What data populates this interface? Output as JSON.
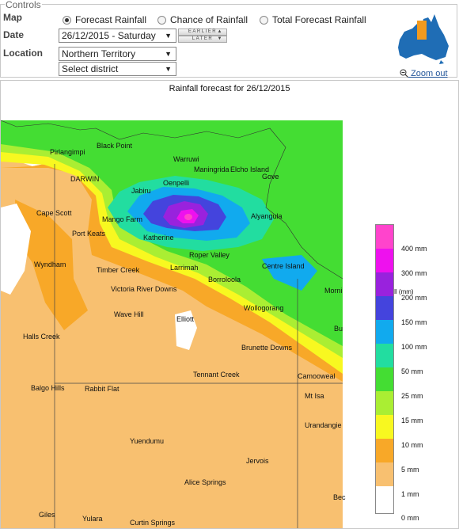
{
  "controls": {
    "legend": "Controls",
    "map_label": "Map",
    "date_label": "Date",
    "location_label": "Location",
    "map_options": [
      {
        "label": "Forecast Rainfall",
        "selected": true
      },
      {
        "label": "Chance of Rainfall",
        "selected": false
      },
      {
        "label": "Total Forecast Rainfall",
        "selected": false
      }
    ],
    "date_value": "26/12/2015 - Saturday",
    "earlier_label": "EARLIER",
    "later_label": "LATER",
    "location_value": "Northern Territory",
    "district_value": "Select district",
    "zoom_label": "Zoom out"
  },
  "map": {
    "title": "Rainfall forecast for 26/12/2015",
    "legend_title": "Rainfall (mm)",
    "legend": [
      {
        "label": "400 mm",
        "color": "#ff44cc"
      },
      {
        "label": "300 mm",
        "color": "#ee11ee"
      },
      {
        "label": "200 mm",
        "color": "#9922dd"
      },
      {
        "label": "150 mm",
        "color": "#4444dd"
      },
      {
        "label": "100 mm",
        "color": "#11aaee"
      },
      {
        "label": "50 mm",
        "color": "#22dda0"
      },
      {
        "label": "25 mm",
        "color": "#44dd33"
      },
      {
        "label": "15 mm",
        "color": "#aaee33"
      },
      {
        "label": "10 mm",
        "color": "#f8f820"
      },
      {
        "label": "5 mm",
        "color": "#f8a828"
      },
      {
        "label": "1 mm",
        "color": "#f8c070"
      },
      {
        "label": "0 mm",
        "color": "#ffffff"
      }
    ],
    "places": [
      "Pirlangimpi",
      "Black Point",
      "Warruwi",
      "Maningrida",
      "Elcho Island",
      "Gove",
      "DARWIN",
      "Oenpelli",
      "Jabiru",
      "Alyangula",
      "Cape Scott",
      "Mango Farm",
      "Port Keats",
      "Katherine",
      "Roper Valley",
      "Centre Island",
      "Wyndham",
      "Timber Creek",
      "Larrimah",
      "Borroloola",
      "Morni",
      "Victoria River Downs",
      "Wollogorang",
      "Wave Hill",
      "Elliott",
      "Bu",
      "Halls Creek",
      "Brunette Downs",
      "Tennant Creek",
      "Camooweal",
      "Balgo Hills",
      "Rabbit Flat",
      "Mt Isa",
      "Urandangie",
      "Yuendumu",
      "Jervois",
      "Alice Springs",
      "Bec",
      "Giles",
      "Yulara",
      "Curtin Springs"
    ]
  }
}
